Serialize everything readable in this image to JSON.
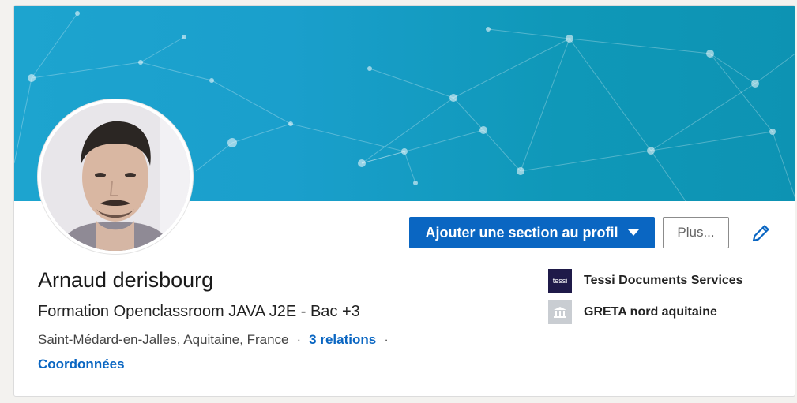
{
  "profile": {
    "name": "Arnaud derisbourg",
    "headline": "Formation Openclassroom JAVA J2E - Bac +3",
    "location": "Saint-Médard-en-Jalles, Aquitaine, France",
    "separator": "·",
    "relations": "3 relations",
    "contact_info": "Coordonnées"
  },
  "actions": {
    "add_section_label": "Ajouter une section au profil",
    "more_label": "Plus..."
  },
  "organizations": [
    {
      "name": "Tessi Documents Services",
      "logo_text": "tessi",
      "icon": "tessi-logo"
    },
    {
      "name": "GRETA nord aquitaine",
      "icon": "school-building-icon"
    }
  ],
  "colors": {
    "accent": "#0a66c2",
    "banner_start": "#1da4cf",
    "banner_end": "#0d93b3"
  }
}
